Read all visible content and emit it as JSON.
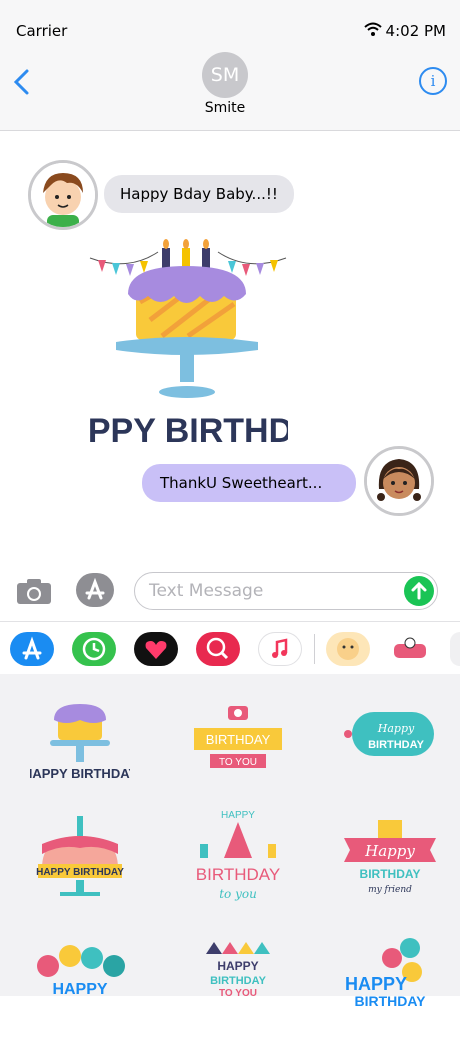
{
  "status_bar": {
    "carrier": "Carrier",
    "time": "4:02 PM"
  },
  "nav": {
    "back_icon": "chevron-left-icon",
    "contact_initials": "SM",
    "contact_name": "Smite",
    "info_icon": "info-icon"
  },
  "messages": [
    {
      "direction": "incoming",
      "text": "Happy Bday Baby...!!"
    },
    {
      "direction": "incoming",
      "type": "sticker",
      "sticker_text": "HAPPY BIRTHDAY"
    },
    {
      "direction": "outgoing",
      "text": "ThankU Sweetheart..."
    }
  ],
  "composer": {
    "placeholder": "Text Message",
    "camera_icon": "camera-icon",
    "appstore_icon": "appstore-icon",
    "send_icon": "send-arrow-icon"
  },
  "app_drawer": [
    "appstore",
    "recents",
    "digital-touch",
    "images-search",
    "music",
    "sticker-pack-1",
    "sticker-pack-2",
    "more"
  ],
  "stickers": [
    {
      "line1": "HAPPY BIRTHDAY"
    },
    {
      "line1": "BIRTHDAY",
      "line2": "TO YOU"
    },
    {
      "line1": "Happy",
      "line2": "BIRTHDAY"
    },
    {
      "line1": "HAPPY BIRTHDAY"
    },
    {
      "line1": "HAPPY",
      "line2": "BIRTHDAY",
      "line3": "to you"
    },
    {
      "line1": "Happy",
      "line2": "BIRTHDAY",
      "line3": "my friend"
    },
    {
      "line1": "HAPPY"
    },
    {
      "line1": "HAPPY",
      "line2": "BIRTHDAY",
      "line3": "TO YOU"
    },
    {
      "line1": "HAPPY",
      "line2": "BIRTHDAY"
    }
  ],
  "colors": {
    "accent": "#2d8bf0",
    "send": "#1ac455",
    "outgoing_bubble": "#c9c0f7",
    "incoming_bubble": "#e5e5ea"
  }
}
